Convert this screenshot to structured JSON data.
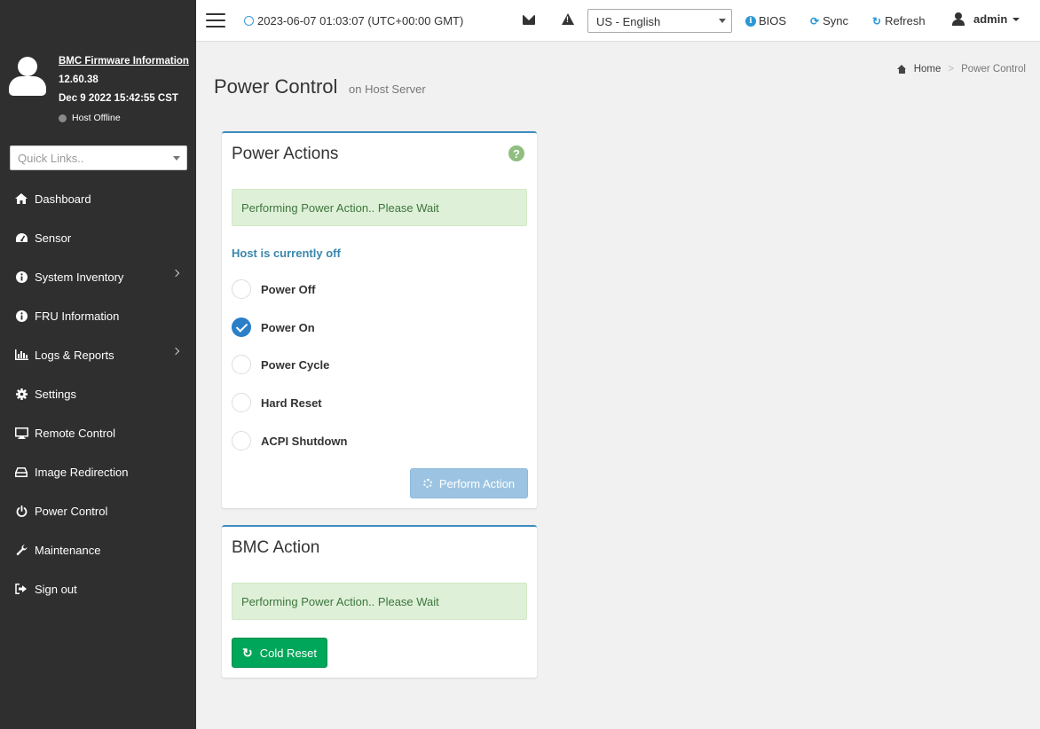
{
  "sidebar": {
    "firmware_link": "BMC Firmware Information",
    "firmware_version": "12.60.38",
    "firmware_date": "Dec 9 2022 15:42:55 CST",
    "host_status": "Host Offline",
    "quick_links_placeholder": "Quick Links..",
    "items": [
      {
        "label": "Dashboard",
        "icon": "home-icon"
      },
      {
        "label": "Sensor",
        "icon": "gauge-icon"
      },
      {
        "label": "System Inventory",
        "icon": "info-icon"
      },
      {
        "label": "FRU Information",
        "icon": "info-icon"
      },
      {
        "label": "Logs & Reports",
        "icon": "bar-chart-icon"
      },
      {
        "label": "Settings",
        "icon": "gear-icon"
      },
      {
        "label": "Remote Control",
        "icon": "monitor-icon"
      },
      {
        "label": "Image Redirection",
        "icon": "drive-icon"
      },
      {
        "label": "Power Control",
        "icon": "power-icon"
      },
      {
        "label": "Maintenance",
        "icon": "wrench-icon"
      },
      {
        "label": "Sign out",
        "icon": "sign-out-icon"
      }
    ]
  },
  "topbar": {
    "datetime": "2023-06-07 01:03:07 (UTC+00:00 GMT)",
    "language": "US - English",
    "bios_label": "BIOS",
    "sync_label": "Sync",
    "refresh_label": "Refresh",
    "user": "admin"
  },
  "page": {
    "title": "Power Control",
    "subtitle": "on Host Server",
    "breadcrumb_home": "Home",
    "breadcrumb_current": "Power Control"
  },
  "power_actions": {
    "title": "Power Actions",
    "alert": "Performing Power Action.. Please Wait",
    "host_state": "Host is currently off",
    "options": [
      {
        "label": "Power Off",
        "checked": false
      },
      {
        "label": "Power On",
        "checked": true
      },
      {
        "label": "Power Cycle",
        "checked": false
      },
      {
        "label": "Hard Reset",
        "checked": false
      },
      {
        "label": "ACPI Shutdown",
        "checked": false
      }
    ],
    "perform_label": "Perform Action"
  },
  "bmc_action": {
    "title": "BMC Action",
    "alert": "Performing Power Action.. Please Wait",
    "cold_reset_label": "Cold Reset"
  },
  "colors": {
    "sidebar_bg": "#2f2f2f",
    "accent": "#3c8dbc",
    "success": "#00a65a",
    "alert_bg": "#dff0d8"
  }
}
